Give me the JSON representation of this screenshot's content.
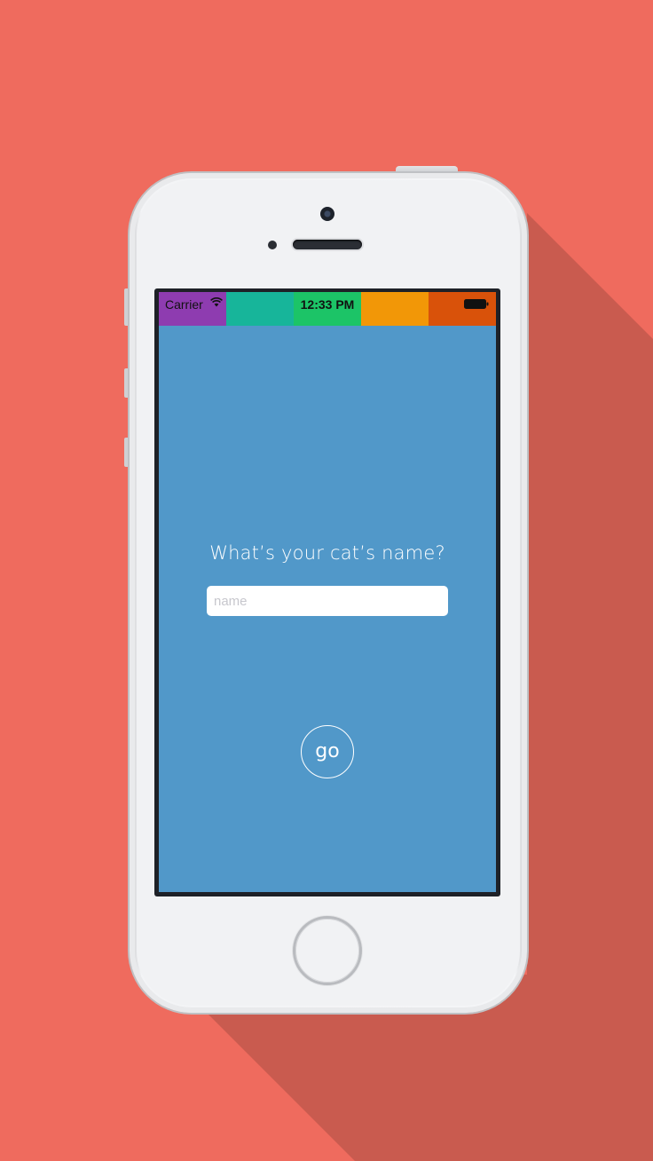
{
  "background_color": "#ef6b5e",
  "status_bar": {
    "carrier": "Carrier",
    "time": "12:33 PM",
    "wifi_icon": "wifi-icon",
    "battery_icon": "battery-icon",
    "segment_colors": [
      "#8e3cb0",
      "#17b59a",
      "#1cc467",
      "#f29707",
      "#d9520a"
    ]
  },
  "screen": {
    "background_color": "#5198c9",
    "question": "What’s your cat’s name?",
    "name_input": {
      "placeholder": "name",
      "value": ""
    },
    "go_label": "go"
  }
}
